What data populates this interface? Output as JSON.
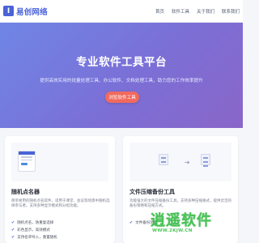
{
  "header": {
    "logo_mark": "I",
    "brand": "易创网络",
    "nav": [
      "首页",
      "软件工具",
      "关于我们",
      "联系我们"
    ]
  },
  "hero": {
    "title": "专业软件工具平台",
    "subtitle": "提供高效实用的批量处理工具、办公软件、文档处理工具，助力您的工作效率提升",
    "button": "浏览软件工具"
  },
  "cards": [
    {
      "title": "随机点名器",
      "desc": "简单易用的随机点名软件，适用于课堂、会议等场景中随机选择参与者。支持多种显示模式和分组功能。",
      "features": [
        "随机点名，防重复选择",
        "彩色显示，高效模式",
        "支持名单导入，重置随机"
      ]
    },
    {
      "title": "文件压缩备份工具",
      "desc": "功能强大的文件压缩备份工具，支持多种压缩格式，提供灵活的备份策略和压缩方式。",
      "features": [
        "文件备份功能"
      ]
    }
  ],
  "watermark": {
    "text": "逍遥软件",
    "url": "WWW.2KJW.CN"
  },
  "colors": {
    "brand": "#4a63d8",
    "hero_start": "#6f86e6",
    "hero_end": "#8a66c8",
    "cta": "#f06a5e",
    "watermark": "#3bbf4a"
  }
}
